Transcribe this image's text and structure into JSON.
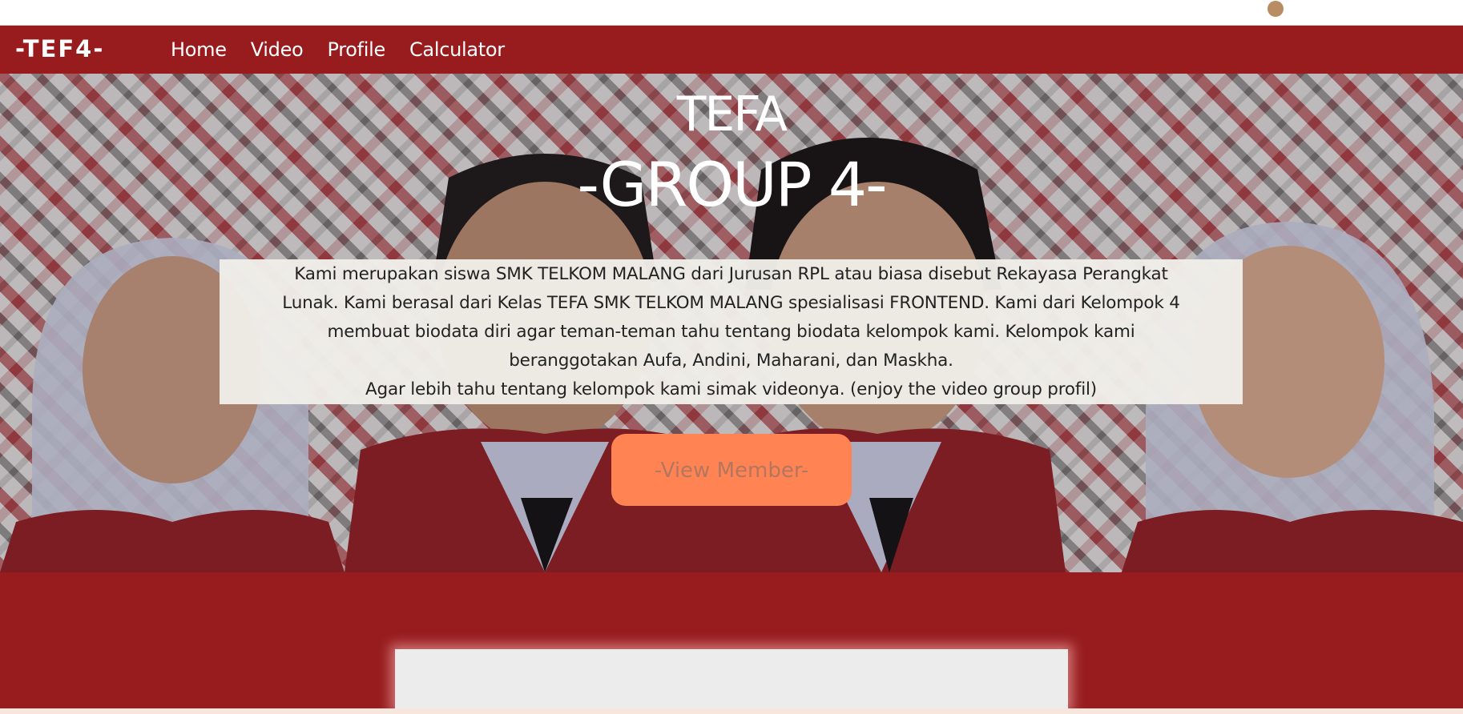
{
  "navbar": {
    "brand": "-TEF4-",
    "links": [
      "Home",
      "Video",
      "Profile",
      "Calculator"
    ]
  },
  "hero": {
    "title": "TEFA",
    "subtitle": "-GROUP 4-",
    "description_lines": [
      "Kami merupakan siswa SMK TELKOM MALANG dari Jurusan RPL atau biasa disebut Rekayasa Perangkat",
      "Lunak. Kami berasal dari Kelas TEFA SMK TELKOM MALANG spesialisasi FRONTEND. Kami dari Kelompok 4",
      "membuat biodata diri agar teman-teman tahu tentang biodata kelompok kami. Kelompok kami",
      "beranggotakan Aufa, Andini, Maharani, dan Maskha.",
      "Agar lebih tahu tentang kelompok kami simak videonya. (enjoy the video group profil)"
    ],
    "button_label": "-View Member-"
  },
  "colors": {
    "nav_bg": "#981c1e",
    "button_bg": "#ff8353",
    "button_text": "#b3765e",
    "desc_bg": "#f0ede8"
  }
}
